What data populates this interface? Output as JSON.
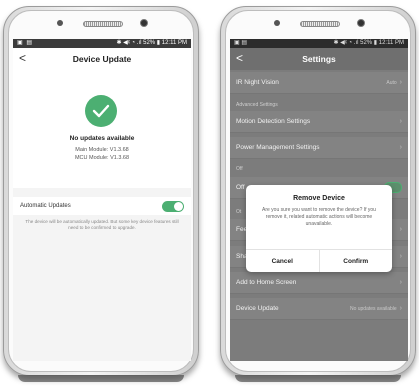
{
  "left": {
    "status": {
      "left": "▣ ▤",
      "right": "✱ ◀ᵡ ⁠◔ .ıl 52% ▮ 12:11 PM"
    },
    "nav": {
      "back": "<",
      "title": "Device Update"
    },
    "update": {
      "status": "No updates available",
      "main_module": "Main Module: V1.3.68",
      "mcu_module": "MCU Module: V1.3.68"
    },
    "automatic_updates": {
      "label": "Automatic Updates",
      "enabled": true,
      "note": "The device will be automatically updated. But some key device features still need to be confirmed to upgrade."
    }
  },
  "right": {
    "status": {
      "left": "▣ ▤",
      "right": "✱ ◀ᵡ ⁠◔ .ıl 52% ▮ 12:11 PM"
    },
    "nav": {
      "back": "<",
      "title": "Settings"
    },
    "rows": {
      "ir": {
        "label": "IR Night Vision",
        "value": "Auto"
      },
      "advanced_header": "Advanced Settings",
      "motion": {
        "label": "Motion Detection Settings"
      },
      "power": {
        "label": "Power Management Settings"
      },
      "off_header": "Off",
      "off_row": {
        "label": "Off"
      },
      "other_header": "Ot",
      "feedback": {
        "label": "Feedback"
      },
      "share": {
        "label": "Share Device"
      },
      "add_home": {
        "label": "Add to Home Screen"
      },
      "device_update": {
        "label": "Device Update",
        "value": "No updates available"
      }
    },
    "dialog": {
      "title": "Remove Device",
      "message": "Are you sure you want to remove the device? If you remove it, related automatic actions will become unavailable.",
      "cancel": "Cancel",
      "confirm": "Confirm"
    }
  },
  "colors": {
    "accent_green": "#4caf72",
    "overlay": "#7c7c7c"
  }
}
